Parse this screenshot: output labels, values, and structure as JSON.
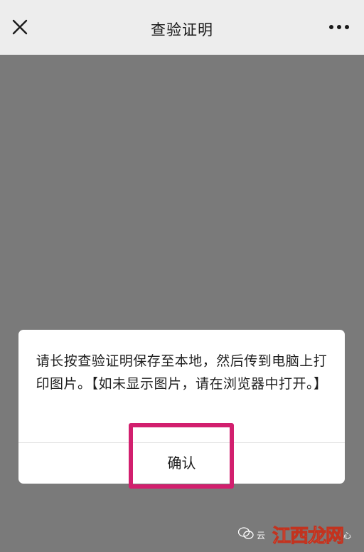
{
  "header": {
    "title": "查验证明"
  },
  "dialog": {
    "message": "请长按查验证明保存至本地，然后传到电脑上打印图片。【如未显示图片，请在浏览器中打开。】",
    "confirm_label": "确认"
  },
  "watermark": {
    "prefix": "云",
    "logo": "江西龙网",
    "suffix": "心"
  },
  "colors": {
    "highlight": "#d21f6e",
    "overlay": "#7a7a7a",
    "topbar": "#ededed"
  }
}
